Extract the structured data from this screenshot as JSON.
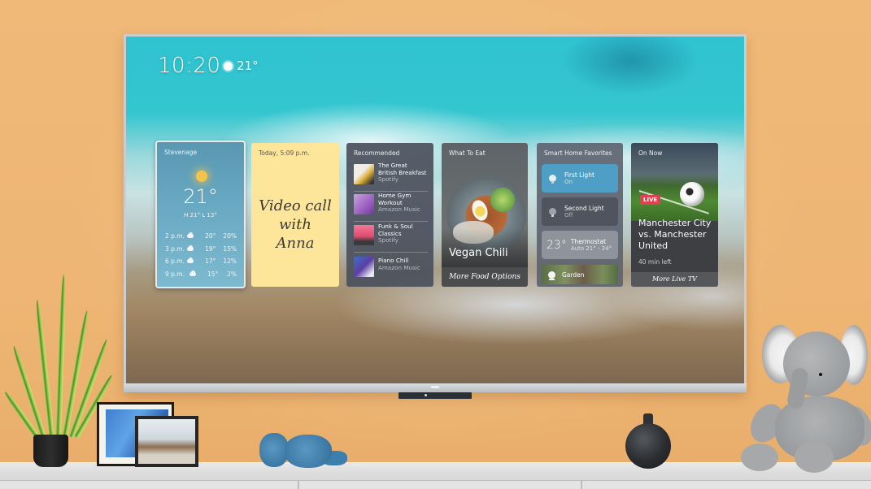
{
  "screen": {
    "clock": "10:20",
    "weather_icon": "sun-icon",
    "current_temp": "21°"
  },
  "widgets": {
    "weather": {
      "location": "Stevenage",
      "icon": "sun-icon",
      "temperature": "21°",
      "high_low": "H 21°  L 13°",
      "forecast": [
        {
          "time": "2 p.m.",
          "icon": "cloud-icon",
          "temp": "20°",
          "precip": "20%"
        },
        {
          "time": "3 p.m.",
          "icon": "cloud-icon",
          "temp": "19°",
          "precip": "15%"
        },
        {
          "time": "6 p.m.",
          "icon": "cloud-icon",
          "temp": "17°",
          "precip": "12%"
        },
        {
          "time": "9 p.m.",
          "icon": "cloud-icon",
          "temp": "15°",
          "precip": "2%"
        }
      ]
    },
    "note": {
      "timestamp": "Today, 5:09 p.m.",
      "text_line1": "Video call",
      "text_line2": "with",
      "text_line3": "Anna"
    },
    "recommended": {
      "title": "Recommended",
      "items": [
        {
          "title_line1": "The Great",
          "title_line2": "British Breakfast",
          "source": "Spotify",
          "thumb_color": "#e9e6df"
        },
        {
          "title_line1": "Home Gym",
          "title_line2": "Workout",
          "source": "Amazon Music",
          "thumb_color": "#a86fc4"
        },
        {
          "title_line1": "Funk & Soul",
          "title_line2": "Classics",
          "source": "Spotify",
          "thumb_color": "#e6507a"
        },
        {
          "title_line1": "Piano Chill",
          "title_line2": "",
          "source": "Amazon Music",
          "thumb_color": "#5a3f9c"
        }
      ]
    },
    "food": {
      "title": "What To Eat",
      "dish": "Vegan Chili",
      "more_label": "More Food Options"
    },
    "smart_home": {
      "title": "Smart Home Favorites",
      "devices": [
        {
          "name": "First Light",
          "state": "On",
          "icon": "light-bulb-icon"
        },
        {
          "name": "Second Light",
          "state": "Off",
          "icon": "light-bulb-icon"
        }
      ],
      "thermostat": {
        "temp": "23°",
        "name": "Thermostat",
        "mode": "Auto 21° - 24°"
      },
      "camera": {
        "name": "Garden",
        "icon": "camera-icon"
      }
    },
    "on_now": {
      "title": "On Now",
      "badge": "LIVE",
      "match_line1": "Manchester City",
      "match_line2": "vs. Manchester",
      "match_line3": "United",
      "time_left": "40 min left",
      "more_label": "More Live TV"
    }
  },
  "colors": {
    "wall": "#eeb574",
    "note_yellow": "#fde59a",
    "light_on": "#4e9ec6",
    "live_red": "#e0404f"
  }
}
